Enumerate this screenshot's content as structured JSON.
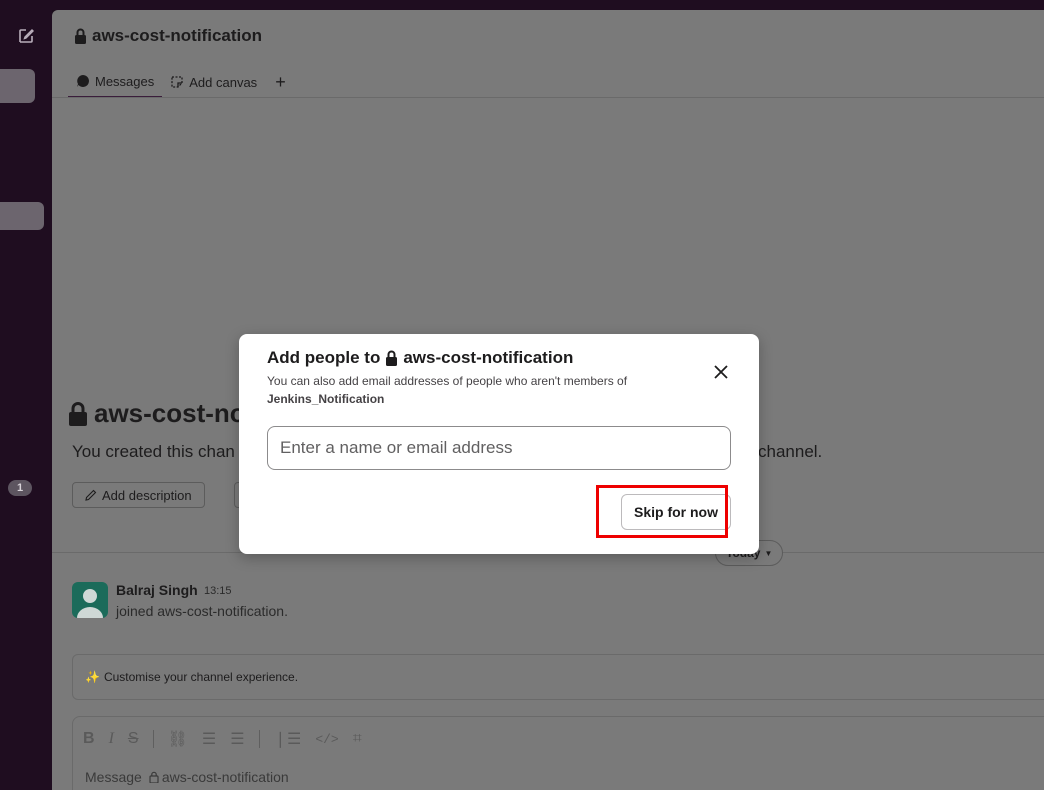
{
  "channel": {
    "name": "aws-cost-notification"
  },
  "tabs": {
    "messages": "Messages",
    "add_canvas": "Add canvas",
    "plus": "+"
  },
  "sidebar": {
    "badge": "1"
  },
  "intro": {
    "title": "aws-cost-no",
    "desc_start": "You created this chan",
    "desc_end": "channel.",
    "add_description": "Add description"
  },
  "divider": {
    "today": "Today"
  },
  "message": {
    "author": "Balraj Singh",
    "time": "13:15",
    "text": "joined aws-cost-notification."
  },
  "customise": {
    "emoji": "✨",
    "text": "Customise your channel experience."
  },
  "composer": {
    "placeholder_prefix": "Message",
    "placeholder_channel": "aws-cost-notification"
  },
  "modal": {
    "title_prefix": "Add people to",
    "title_channel": "aws-cost-notification",
    "subtitle": "You can also add email addresses of people who aren't members of",
    "workspace": "Jenkins_Notification",
    "input_placeholder": "Enter a name or email address",
    "skip_label": "Skip for now"
  },
  "colors": {
    "sidebar": "#1f0d20",
    "overlay_bg": "#7a7a7a",
    "modal_bg": "#ffffff",
    "highlight": "#ee0000"
  }
}
